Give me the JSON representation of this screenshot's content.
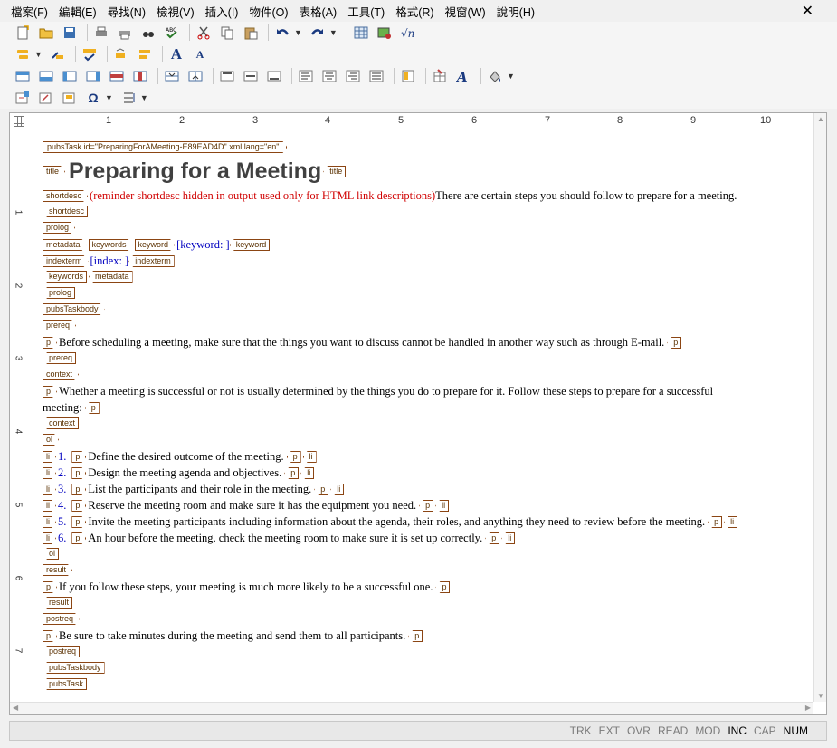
{
  "menu": [
    "檔案(F)",
    "編輯(E)",
    "尋找(N)",
    "檢視(V)",
    "插入(I)",
    "物件(O)",
    "表格(A)",
    "工具(T)",
    "格式(R)",
    "視窗(W)",
    "說明(H)"
  ],
  "close_glyph": "✕",
  "ruler": [
    "1",
    "2",
    "3",
    "4",
    "5",
    "6",
    "7",
    "8",
    "9",
    "10"
  ],
  "vruler": [
    "1",
    "2",
    "3",
    "4",
    "5",
    "6",
    "7"
  ],
  "tags": {
    "pubsTask_open": "pubsTask id=\"PreparingForAMeeting-E89EAD4D\" xml:lang=\"en\"",
    "title": "title",
    "shortdesc": "shortdesc",
    "prolog": "prolog",
    "metadata": "metadata",
    "keywords": "keywords",
    "keyword": "keyword",
    "indexterm": "indexterm",
    "pubsTaskbody": "pubsTaskbody",
    "prereq": "prereq",
    "p": "p",
    "context": "context",
    "ol": "ol",
    "li": "li",
    "result": "result",
    "postreq": "postreq",
    "pubsTask": "pubsTask"
  },
  "doc": {
    "title": "Preparing for a Meeting",
    "shortdesc_hidden": "(reminder shortdesc hidden in output used only for HTML link descriptions)",
    "shortdesc_text": "There are certain steps you should follow to prepare for a meeting.",
    "keyword_placeholder": "[keyword: ]",
    "index_placeholder": "[index: ]",
    "prereq_text": "Before scheduling a meeting, make sure that the things you want to discuss cannot be handled in another way such as through E-mail.",
    "context_text_1": "Whether a meeting is successful or not is usually determined by the things you do to prepare for it. Follow these steps to prepare for a successful",
    "context_text_2": "meeting:",
    "steps": [
      {
        "num": "1.",
        "text": "Define the desired outcome of the meeting."
      },
      {
        "num": "2.",
        "text": "Design the meeting agenda and objectives."
      },
      {
        "num": "3.",
        "text": "List the participants and their role in the meeting."
      },
      {
        "num": "4.",
        "text": "Reserve the meeting room and make sure it has the equipment you need."
      },
      {
        "num": "5.",
        "text": "Invite the meeting participants including information about the agenda, their roles, and anything they need to review before the meeting."
      },
      {
        "num": "6.",
        "text": "An hour before the meeting, check the meeting room to make sure it is set up correctly."
      }
    ],
    "result_text": "If you follow these steps, your meeting is much more likely to be a successful one.",
    "postreq_text": "Be sure to take minutes during the meeting and send them to all participants."
  },
  "status": {
    "trk": "TRK",
    "ext": "EXT",
    "ovr": "OVR",
    "read": "READ",
    "mod": "MOD",
    "inc": "INC",
    "cap": "CAP",
    "num": "NUM"
  }
}
